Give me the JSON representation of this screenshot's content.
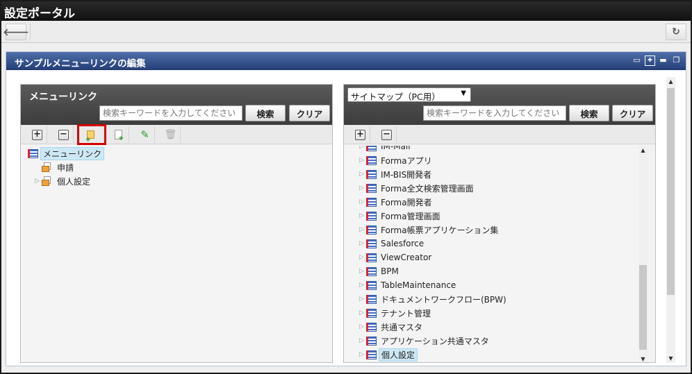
{
  "app": {
    "title": "設定ポータル"
  },
  "nav": {
    "back_icon": "arrow-left-icon",
    "reload_icon": "refresh-icon"
  },
  "portlet": {
    "title": "サンプルメニューリンクの編集",
    "tools": [
      "monitor-icon",
      "settings-icon",
      "minimize-icon",
      "restore-icon"
    ]
  },
  "left_panel": {
    "title": "メニューリンク",
    "search_placeholder": "検索キーワードを入力してください",
    "search_button": "検索",
    "clear_button": "クリア",
    "toolbar": [
      "expand-all-icon",
      "collapse-all-icon",
      "add-folder-icon",
      "add-item-icon",
      "edit-icon",
      "delete-icon"
    ],
    "tree": [
      {
        "label": "メニューリンク",
        "icon": "menu-icon",
        "selected": true
      },
      {
        "label": "申請",
        "icon": "folder-icon"
      },
      {
        "label": "個人設定",
        "icon": "folder-icon"
      }
    ]
  },
  "right_panel": {
    "select_value": "サイトマップ（PC用）",
    "search_placeholder": "検索キーワードを入力してください",
    "search_button": "検索",
    "clear_button": "クリア",
    "toolbar": [
      "expand-all-icon",
      "collapse-all-icon"
    ],
    "tree": [
      {
        "label": "IM-Mail"
      },
      {
        "label": "Formaアプリ"
      },
      {
        "label": "IM-BIS開発者"
      },
      {
        "label": "Forma全文検索管理画面"
      },
      {
        "label": "Forma開発者"
      },
      {
        "label": "Forma管理画面"
      },
      {
        "label": "Forma帳票アプリケーション集"
      },
      {
        "label": "Salesforce"
      },
      {
        "label": "ViewCreator"
      },
      {
        "label": "BPM"
      },
      {
        "label": "TableMaintenance"
      },
      {
        "label": "ドキュメントワークフロー(BPW)"
      },
      {
        "label": "テナント管理"
      },
      {
        "label": "共通マスタ"
      },
      {
        "label": "アプリケーション共通マスタ"
      },
      {
        "label": "個人設定",
        "selected": true
      }
    ]
  },
  "colors": {
    "portlet_header": "#253f78",
    "panel_header": "#3c3c3c",
    "selection": "#cde8f5",
    "highlight": "#d40000"
  }
}
